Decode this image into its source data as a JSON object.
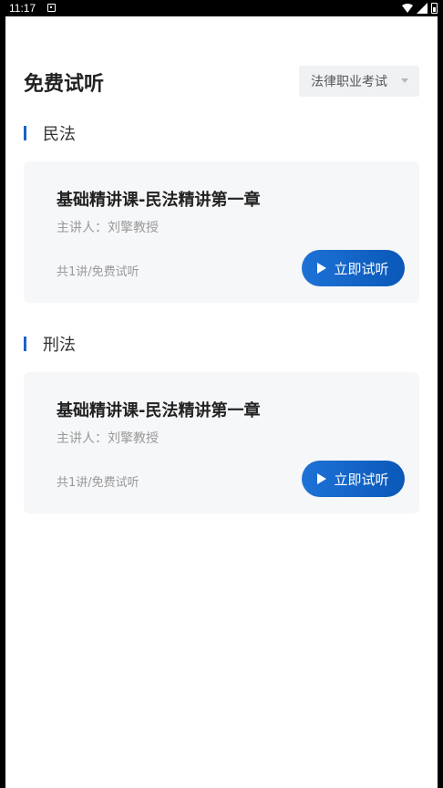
{
  "status_bar": {
    "time": "11:17"
  },
  "header": {
    "title": "免费试听",
    "exam_select": "法律职业考试"
  },
  "sections": [
    {
      "title": "民法",
      "course": {
        "title": "基础精讲课-民法精讲第一章",
        "teacher": "主讲人：刘擎教授",
        "meta": "共1讲/免费试听",
        "button": "立即试听"
      }
    },
    {
      "title": "刑法",
      "course": {
        "title": "基础精讲课-民法精讲第一章",
        "teacher": "主讲人：刘擎教授",
        "meta": "共1讲/免费试听",
        "button": "立即试听"
      }
    }
  ],
  "colors": {
    "accent": "#1764c9",
    "card_bg": "#f6f7f9",
    "select_bg": "#f0f1f3"
  }
}
